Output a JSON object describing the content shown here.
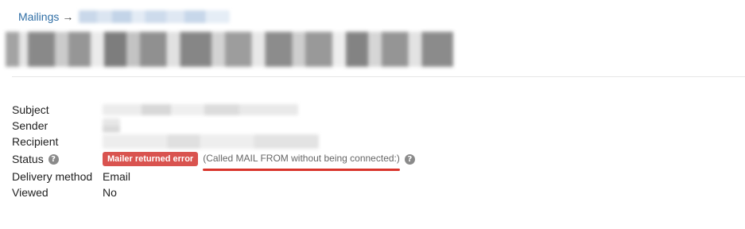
{
  "breadcrumb": {
    "root_label": "Mailings",
    "separator": "→",
    "current_label": ""
  },
  "details": {
    "subject_label": "Subject",
    "sender_label": "Sender",
    "recipient_label": "Recipient",
    "status_label": "Status",
    "status_badge": "Mailer returned error",
    "status_message": "(Called MAIL FROM without being connected:)",
    "delivery_method_label": "Delivery method",
    "delivery_method_value": "Email",
    "viewed_label": "Viewed",
    "viewed_value": "No"
  },
  "icons": {
    "help": "question-circle-icon"
  },
  "colors": {
    "link": "#2f6ea5",
    "error_badge": "#d9534f",
    "underline": "#d9342b"
  }
}
